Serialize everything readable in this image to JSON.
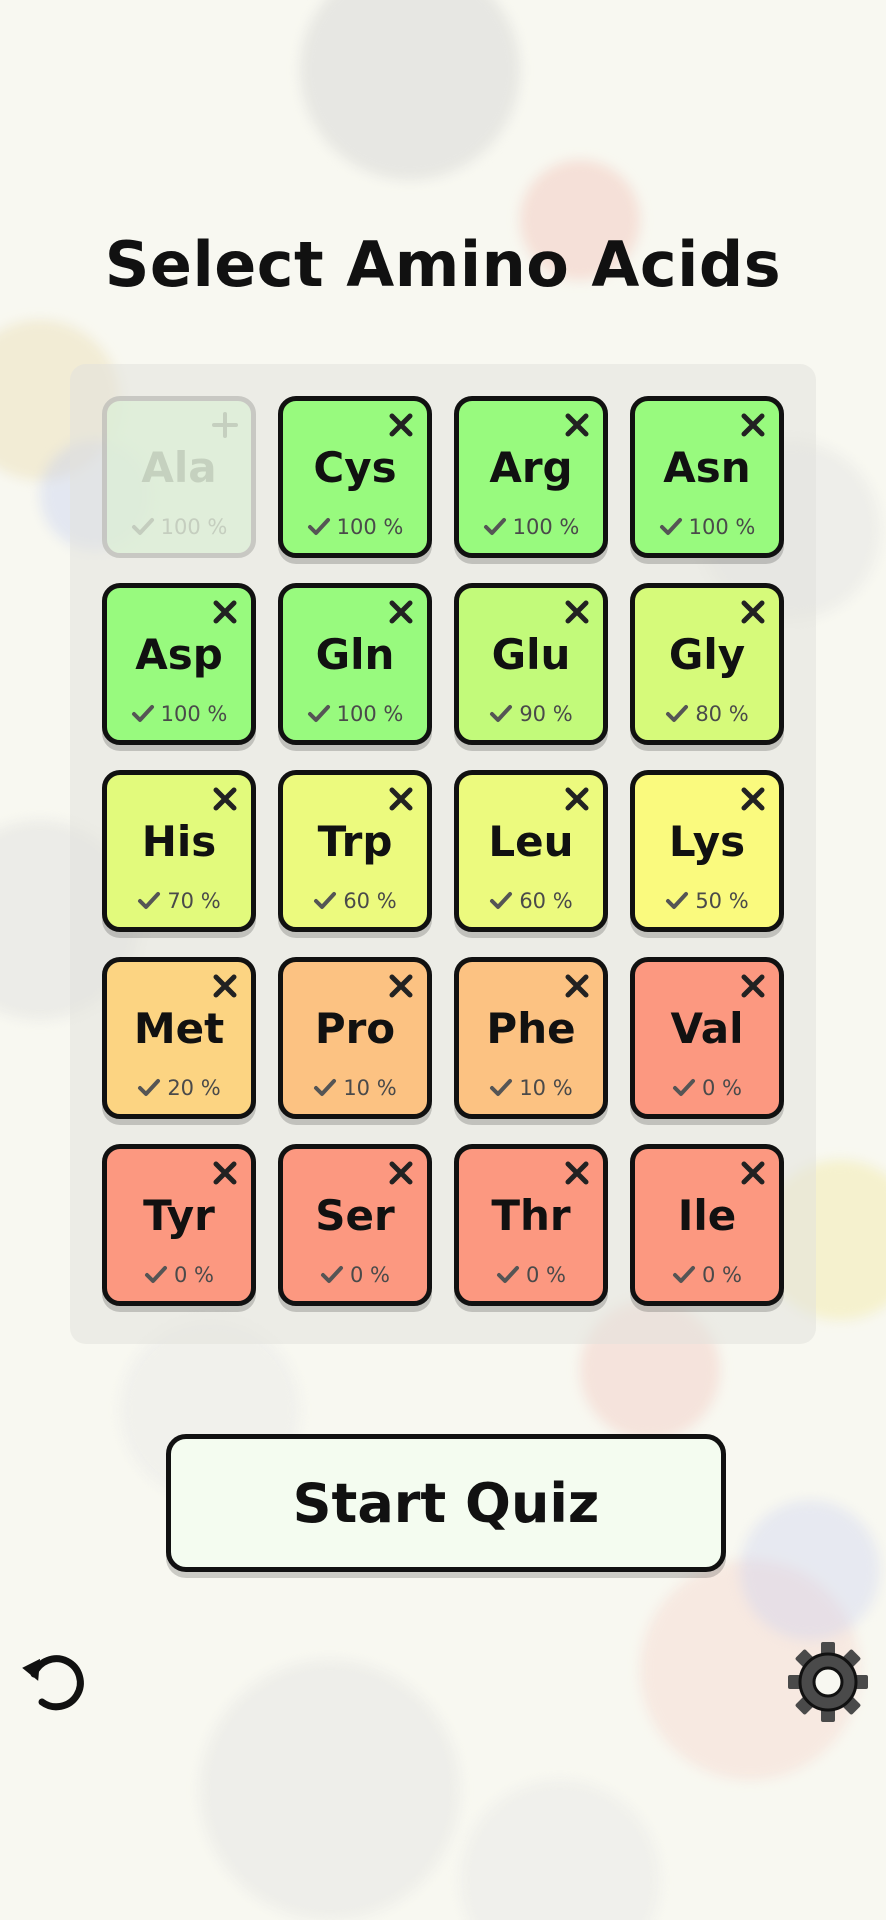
{
  "screen": {
    "title": "Select Amino Acids",
    "start_button_label": "Start Quiz"
  },
  "icons": {
    "undo": "undo-icon",
    "settings": "gear-icon",
    "remove": "close-icon",
    "add": "plus-icon",
    "score": "check-icon"
  },
  "amino_acids": [
    {
      "name": "Ala",
      "score": "100 %",
      "selected": false,
      "color": "#dcefd6"
    },
    {
      "name": "Cys",
      "score": "100 %",
      "selected": true,
      "color": "#98fa7e"
    },
    {
      "name": "Arg",
      "score": "100 %",
      "selected": true,
      "color": "#98fa7e"
    },
    {
      "name": "Asn",
      "score": "100 %",
      "selected": true,
      "color": "#98fa7e"
    },
    {
      "name": "Asp",
      "score": "100 %",
      "selected": true,
      "color": "#98fa7e"
    },
    {
      "name": "Gln",
      "score": "100 %",
      "selected": true,
      "color": "#98fa7e"
    },
    {
      "name": "Glu",
      "score": "90 %",
      "selected": true,
      "color": "#c2fa7a"
    },
    {
      "name": "Gly",
      "score": "80 %",
      "selected": true,
      "color": "#d6fa7a"
    },
    {
      "name": "His",
      "score": "70 %",
      "selected": true,
      "color": "#e2fa7c"
    },
    {
      "name": "Trp",
      "score": "60 %",
      "selected": true,
      "color": "#ecfa7e"
    },
    {
      "name": "Leu",
      "score": "60 %",
      "selected": true,
      "color": "#ecfa7e"
    },
    {
      "name": "Lys",
      "score": "50 %",
      "selected": true,
      "color": "#fafa7e"
    },
    {
      "name": "Met",
      "score": "20 %",
      "selected": true,
      "color": "#fcd482"
    },
    {
      "name": "Pro",
      "score": "10 %",
      "selected": true,
      "color": "#fcc282"
    },
    {
      "name": "Phe",
      "score": "10 %",
      "selected": true,
      "color": "#fcc282"
    },
    {
      "name": "Val",
      "score": "0 %",
      "selected": true,
      "color": "#fc9880"
    },
    {
      "name": "Tyr",
      "score": "0 %",
      "selected": true,
      "color": "#fc9880"
    },
    {
      "name": "Ser",
      "score": "0 %",
      "selected": true,
      "color": "#fc9880"
    },
    {
      "name": "Thr",
      "score": "0 %",
      "selected": true,
      "color": "#fc9880"
    },
    {
      "name": "Ile",
      "score": "0 %",
      "selected": true,
      "color": "#fc9880"
    }
  ]
}
